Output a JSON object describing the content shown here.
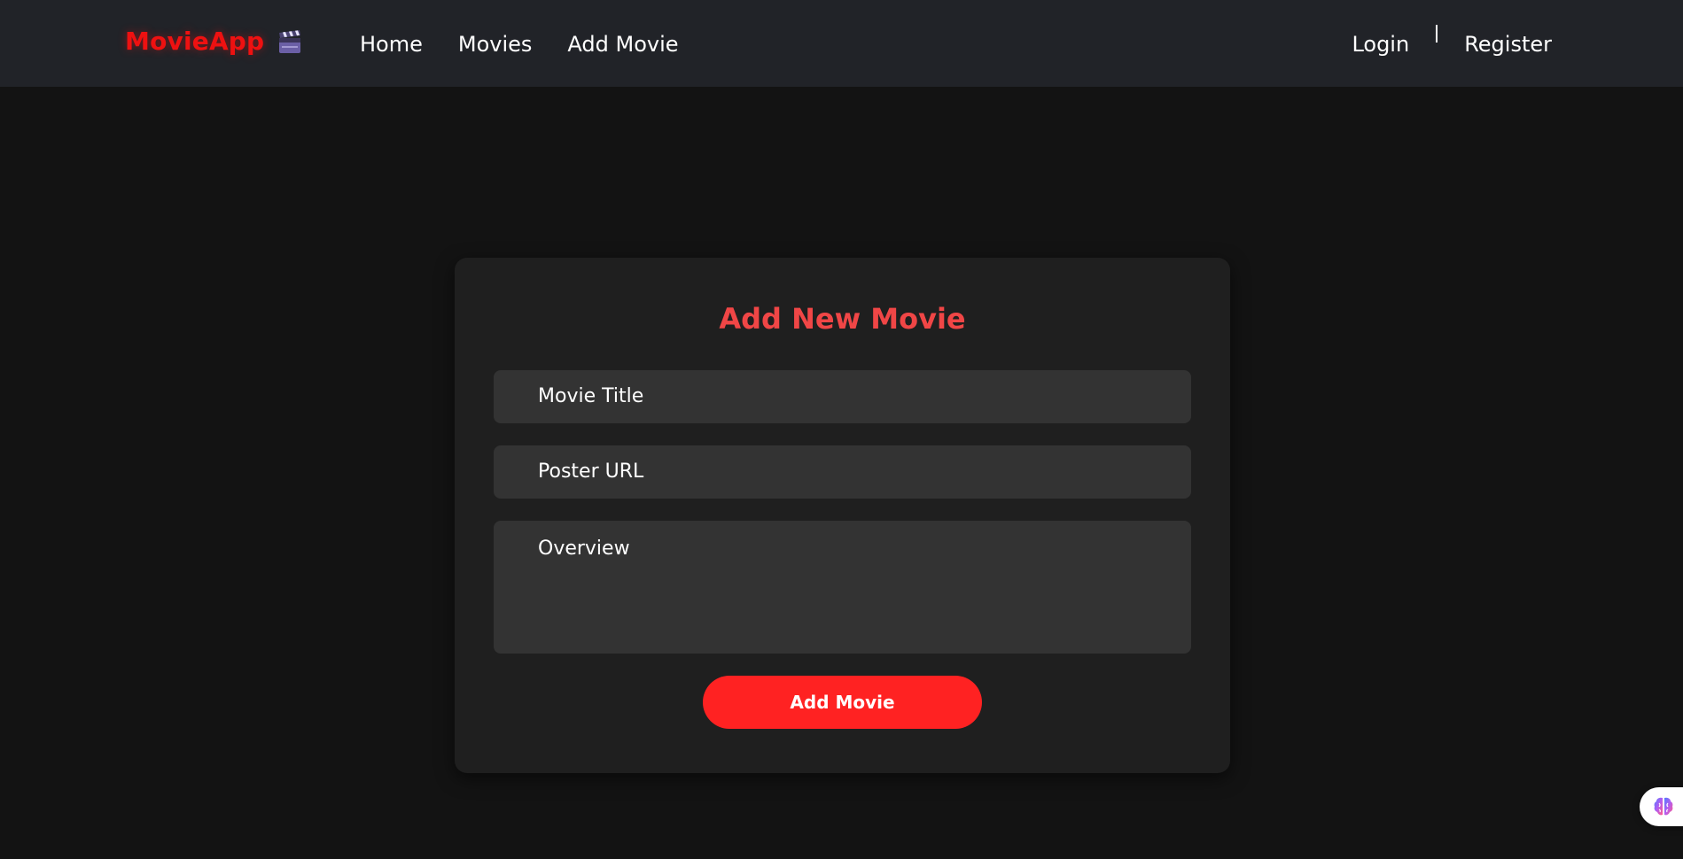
{
  "header": {
    "brand": "MovieApp",
    "brand_icon": "clapper-board-icon",
    "brand_color": "#ee1111",
    "nav": [
      {
        "label": "Home"
      },
      {
        "label": "Movies"
      },
      {
        "label": "Add Movie"
      }
    ],
    "auth": {
      "login_label": "Login",
      "divider": "|",
      "register_label": "Register"
    }
  },
  "form": {
    "title": "Add New Movie",
    "title_color": "#f04646",
    "fields": {
      "title_placeholder": "Movie Title",
      "poster_placeholder": "Poster URL",
      "overview_placeholder": "Overview"
    },
    "submit_label": "Add Movie",
    "submit_color": "#ff2222"
  },
  "widget": {
    "icon": "brain-icon"
  },
  "colors": {
    "page_bg": "#131313",
    "navbar_bg": "#212328",
    "card_bg": "#1f1f1f",
    "field_bg": "#333333"
  }
}
